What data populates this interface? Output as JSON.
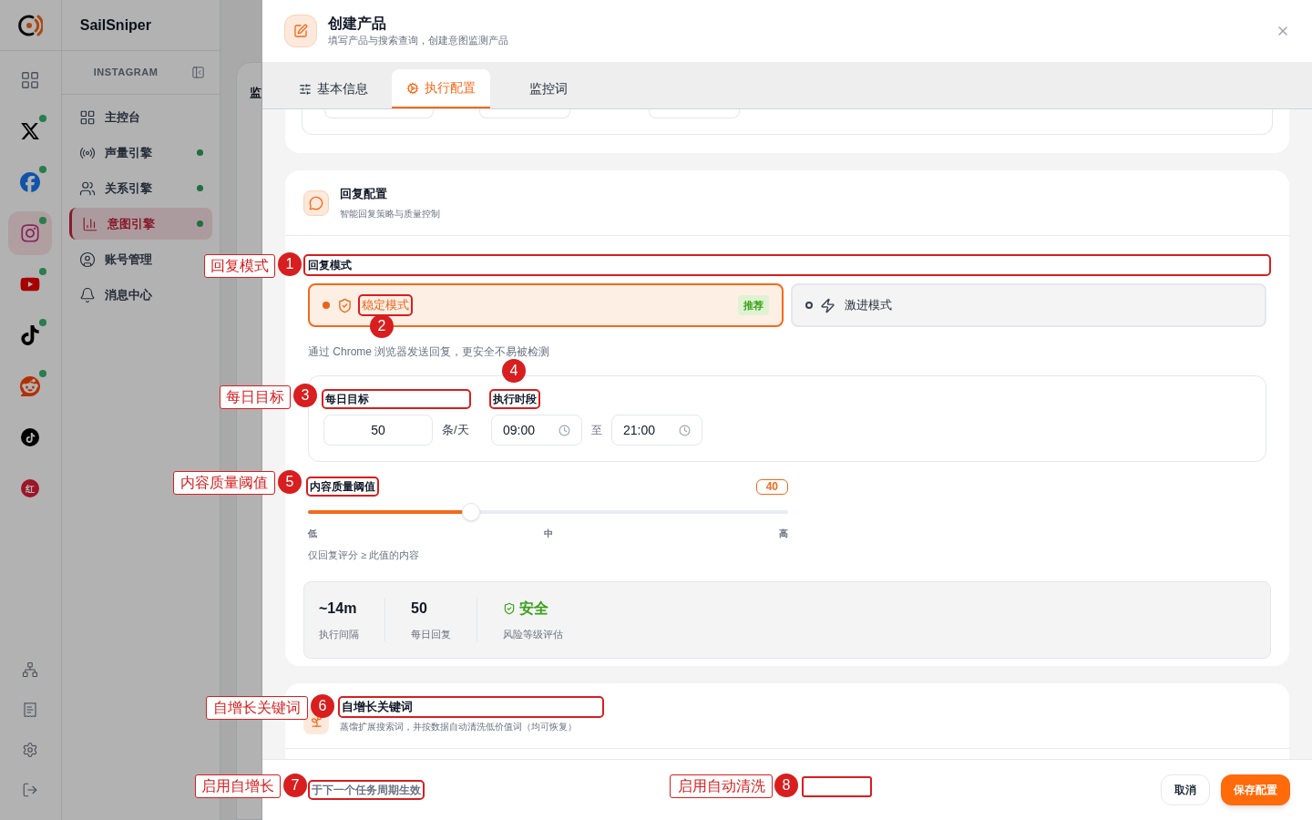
{
  "brand": {
    "name": "SailSniper"
  },
  "rail_items": [
    {
      "kind": "grid",
      "selected": false,
      "online": false
    },
    {
      "kind": "x",
      "selected": false,
      "online": true
    },
    {
      "kind": "facebook",
      "selected": false,
      "online": true
    },
    {
      "kind": "instagram",
      "selected": true,
      "online": true
    },
    {
      "kind": "youtube",
      "selected": false,
      "online": true
    },
    {
      "kind": "tiktok",
      "selected": false,
      "online": true
    },
    {
      "kind": "reddit",
      "selected": false,
      "online": true
    },
    {
      "kind": "tiktok-round",
      "selected": false,
      "online": false
    },
    {
      "kind": "text-logo",
      "text": "红",
      "selected": false,
      "online": false
    }
  ],
  "sidebar": {
    "header": "INSTAGRAM",
    "items": [
      {
        "kind": "dashboard",
        "label": "主控台",
        "selected": false,
        "online": false
      },
      {
        "kind": "radio",
        "label": "声量引擎",
        "selected": false,
        "online": true
      },
      {
        "kind": "users",
        "label": "关系引擎",
        "selected": false,
        "online": true
      },
      {
        "kind": "chart",
        "label": "意图引擎",
        "selected": true,
        "online": true
      },
      {
        "kind": "account",
        "label": "账号管理",
        "selected": false,
        "online": false
      },
      {
        "kind": "bell",
        "label": "消息中心",
        "selected": false,
        "online": false
      }
    ]
  },
  "background_page": {
    "title": "监"
  },
  "drawer": {
    "title": "创建产品",
    "subtitle": "填写产品与搜索查询，创建意图监测产品",
    "tabs": [
      {
        "kind": "sliders",
        "label": "基本信息",
        "selected": false
      },
      {
        "kind": "gear",
        "label": "执行配置",
        "selected": true
      },
      {
        "kind": "none",
        "label": "监控词",
        "selected": false
      }
    ],
    "reply_card": {
      "title": "回复配置",
      "subtitle": "智能回复策略与质量控制",
      "mode_label": "回复模式",
      "modes": [
        {
          "kind": "shield",
          "label": "稳定模式",
          "badge": "推荐",
          "selected": true
        },
        {
          "kind": "zap",
          "label": "激进模式",
          "selected": false
        }
      ],
      "mode_hint": "通过 Chrome 浏览器发送回复，更安全不易被检测",
      "daily_target": {
        "label": "每日目标",
        "value": "50",
        "unit": "条/天"
      },
      "period": {
        "label": "执行时段",
        "start": "09:00",
        "separator": "至",
        "end": "21:00"
      },
      "quality": {
        "label": "内容质量阈值",
        "value": "40",
        "level": 0.34,
        "ticks": [
          "低",
          "中",
          "高"
        ],
        "hint": "仅回复评分 ≥ 此值的内容"
      },
      "stats": [
        {
          "kind": "plain",
          "value": "~14m",
          "label": "执行间隔"
        },
        {
          "kind": "plain",
          "value": "50",
          "label": "每日回复"
        },
        {
          "kind": "status",
          "value": "安全",
          "label": "风险等级评估"
        }
      ]
    },
    "keyword_card": {
      "title": "自增长关键词",
      "subtitle": "蒸馏扩展搜索词，并按数据自动清洗低价值词（均可恢复）"
    },
    "footer": {
      "note": "于下一个任务周期生效",
      "buttons": [
        {
          "kind": "secondary",
          "label": "取消"
        },
        {
          "kind": "primary",
          "label": "保存配置"
        }
      ]
    }
  },
  "annotations": [
    {
      "number": "1",
      "label": "回复模式"
    },
    {
      "number": "2"
    },
    {
      "number": "3",
      "label": "每日目标"
    },
    {
      "number": "4"
    },
    {
      "number": "5",
      "label": "内容质量阈值"
    },
    {
      "number": "6",
      "label": "自增长关键词"
    },
    {
      "number": "7",
      "label": "启用自增长"
    },
    {
      "number": "8",
      "label": "启用自动清洗"
    }
  ]
}
